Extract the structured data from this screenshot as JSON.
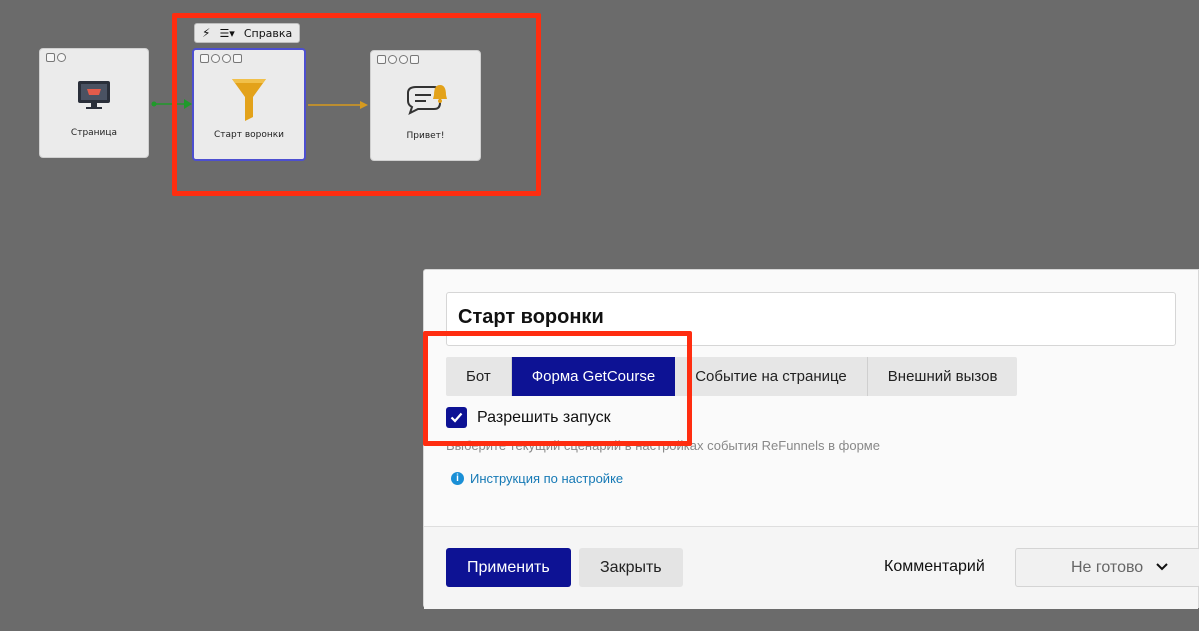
{
  "canvas": {
    "nodes": [
      {
        "id": "page",
        "label": "Страница",
        "icon": "monitor-cart-icon"
      },
      {
        "id": "start",
        "label": "Старт воронки",
        "icon": "funnel-icon"
      },
      {
        "id": "hello",
        "label": "Привет!",
        "icon": "message-bell-icon"
      }
    ],
    "toolbar": {
      "bolt_icon": "lightning-icon",
      "menu_icon": "list-menu-icon",
      "help_label": "Справка"
    }
  },
  "dialog": {
    "title": "Старт воронки",
    "tabs": [
      {
        "label": "Бот"
      },
      {
        "label": "Форма GetCourse"
      },
      {
        "label": "Событие на странице"
      },
      {
        "label": "Внешний вызов"
      }
    ],
    "active_tab": "Форма GetCourse",
    "allow_start": {
      "label": "Разрешить запуск",
      "checked": true
    },
    "hint": "Выберите текущий сценарий в настройках события ReFunnels в форме",
    "instruction_link": "Инструкция по настройке",
    "footer": {
      "apply": "Применить",
      "close": "Закрыть",
      "comment": "Комментарий",
      "status": "Не готово"
    }
  },
  "colors": {
    "accent": "#0d1294",
    "highlight": "#ff2d10",
    "link": "#1579b5",
    "funnel": "#e3a21a"
  }
}
